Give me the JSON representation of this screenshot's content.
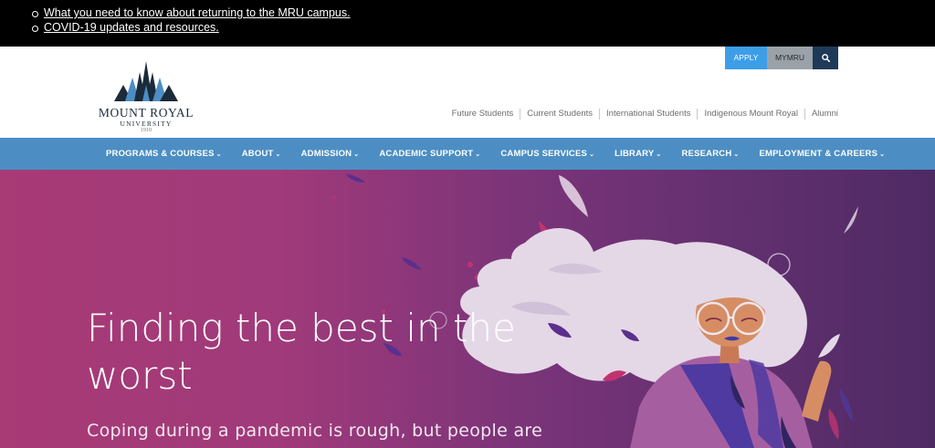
{
  "alerts": [
    {
      "text": "What you need to know about returning to the MRU campus."
    },
    {
      "text": "COVID-19 updates and resources."
    }
  ],
  "logo": {
    "name": "MOUNT ROYAL",
    "sub": "UNIVERSITY",
    "year": "1910"
  },
  "utility": {
    "apply": "APPLY",
    "mymru": "MYMRU",
    "search_icon": "search-icon"
  },
  "audience": [
    "Future Students",
    "Current Students",
    "International Students",
    "Indigenous Mount Royal",
    "Alumni"
  ],
  "nav": [
    "PROGRAMS & COURSES",
    "ABOUT",
    "ADMISSION",
    "ACADEMIC SUPPORT",
    "CAMPUS SERVICES",
    "LIBRARY",
    "RESEARCH",
    "EMPLOYMENT & CAREERS"
  ],
  "hero": {
    "title": "Finding the best in the worst",
    "subtitle": "Coping during a pandemic is rough, but people are"
  },
  "colors": {
    "brand_navy": "#1f3a58",
    "nav_blue": "#4c8ec3",
    "apply_blue": "#3d9ee8",
    "hero_magenta": "#a03a7a",
    "hero_purple": "#4e2a63"
  }
}
